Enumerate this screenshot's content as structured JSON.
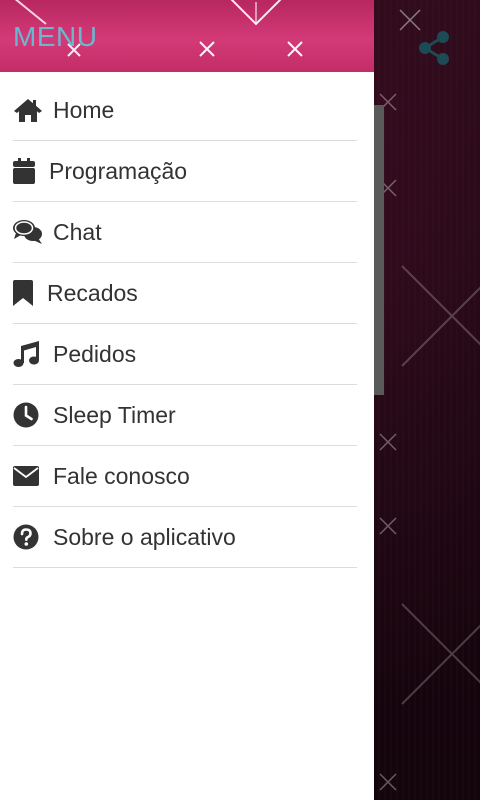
{
  "drawer": {
    "title": "MENU",
    "items": [
      {
        "label": "Home",
        "icon": "home-icon"
      },
      {
        "label": "Programação",
        "icon": "calendar-icon"
      },
      {
        "label": "Chat",
        "icon": "chat-icon"
      },
      {
        "label": "Recados",
        "icon": "bookmark-icon"
      },
      {
        "label": "Pedidos",
        "icon": "music-note-icon"
      },
      {
        "label": "Sleep Timer",
        "icon": "clock-icon"
      },
      {
        "label": "Fale conosco",
        "icon": "envelope-icon"
      },
      {
        "label": "Sobre o aplicativo",
        "icon": "question-circle-icon"
      }
    ]
  },
  "appbar": {
    "share_icon": "share-icon"
  },
  "colors": {
    "header_pink": "#c22d67",
    "title_blue": "#6ab8d0",
    "share_teal": "#1c4a55",
    "text_dark": "#333333",
    "background_dark": "#1e0812"
  }
}
